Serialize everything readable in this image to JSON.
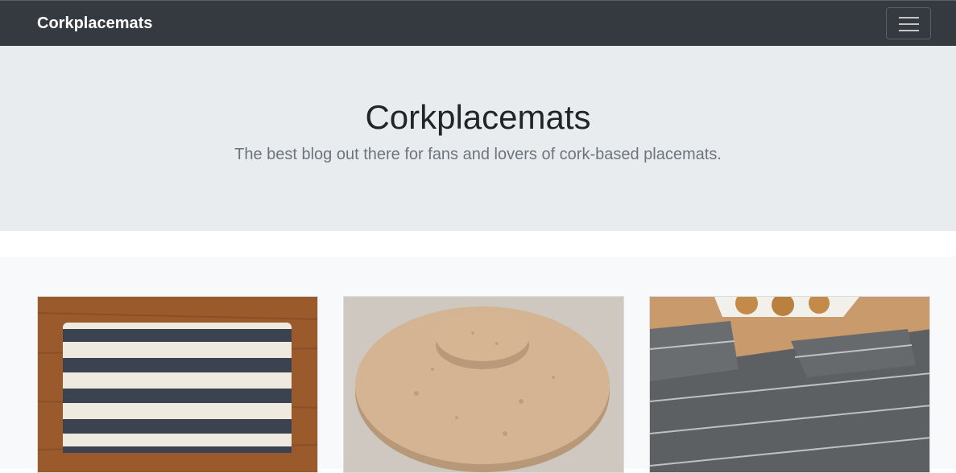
{
  "navbar": {
    "brand": "Corkplacemats"
  },
  "hero": {
    "title": "Corkplacemats",
    "lead": "The best blog out there for fans and lovers of cork-based placemats."
  },
  "cards": [
    {
      "image": "striped-placemat-photo"
    },
    {
      "image": "round-cork-placemats-photo"
    },
    {
      "image": "gray-patterned-placemat-photo"
    }
  ],
  "colors": {
    "navbar": "#343a40",
    "hero": "#e9ecef",
    "album": "#f8f9fa"
  }
}
